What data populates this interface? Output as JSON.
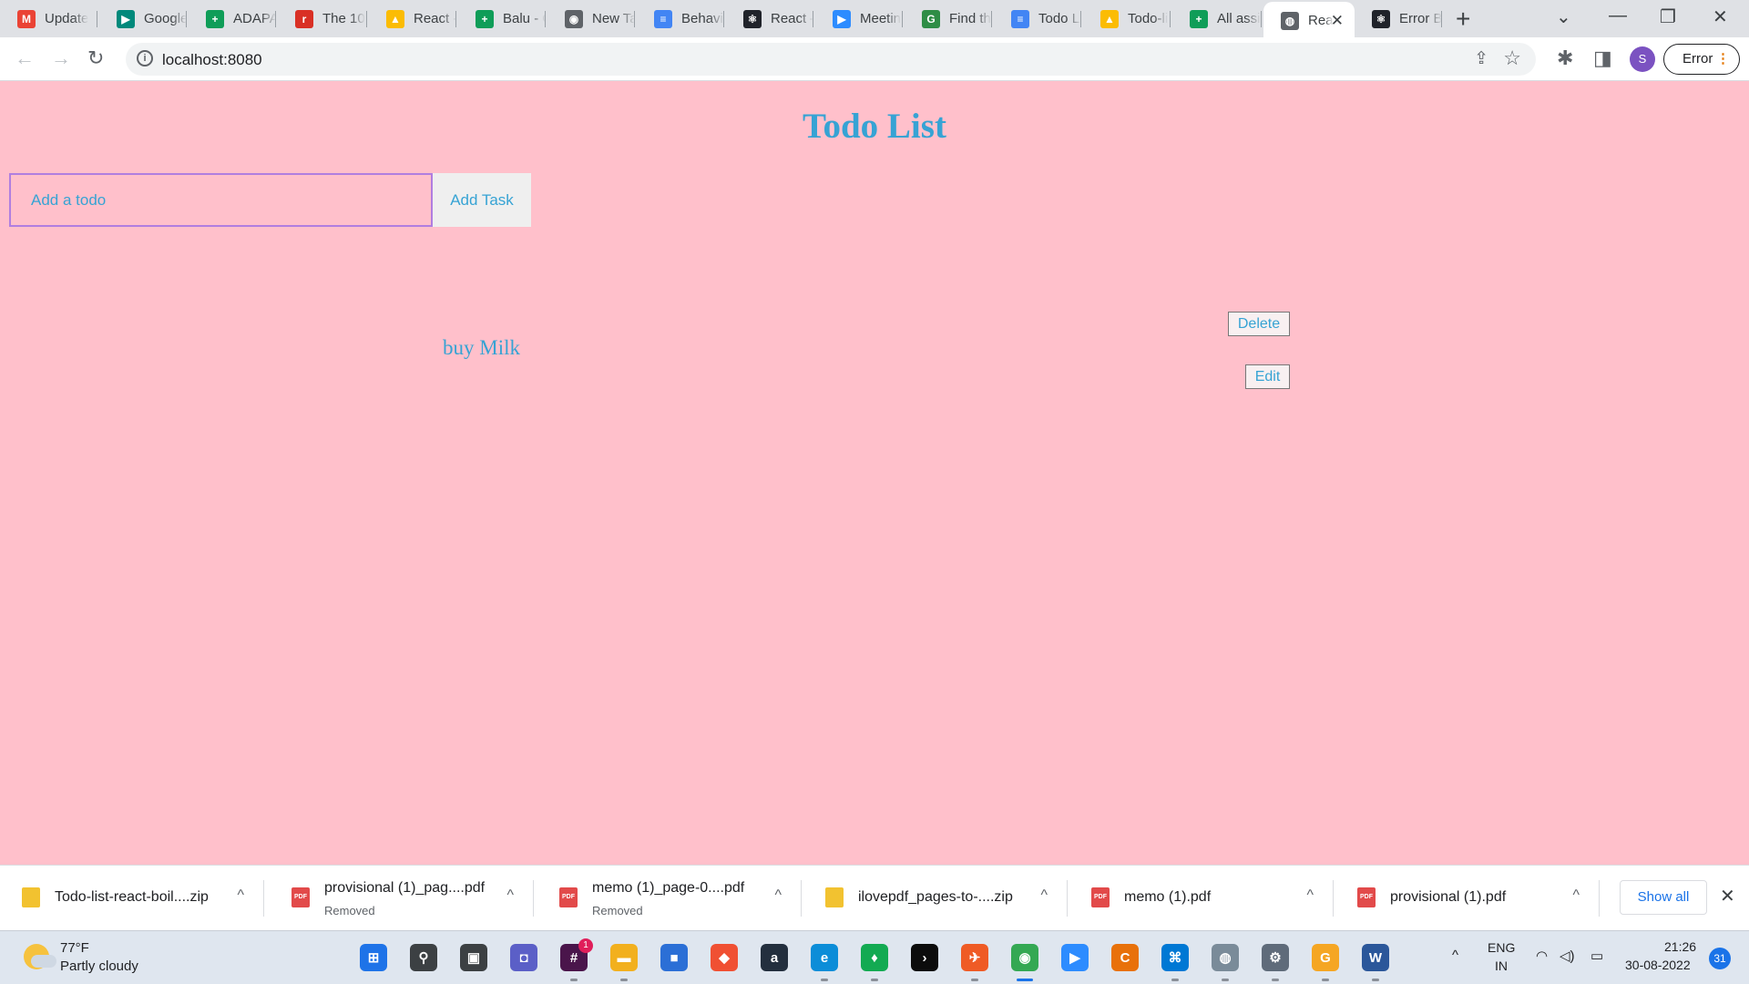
{
  "browser": {
    "tabs": [
      {
        "label": "Update",
        "icon": "gmail-icon",
        "color": "#ea4335",
        "glyph": "M"
      },
      {
        "label": "Google",
        "icon": "google-meet-icon",
        "color": "#00897b",
        "glyph": "▶"
      },
      {
        "label": "ADAPA",
        "icon": "google-sheets-icon",
        "color": "#0f9d58",
        "glyph": "+"
      },
      {
        "label": "The 10",
        "icon": "reduct-icon",
        "color": "#d93025",
        "glyph": "r"
      },
      {
        "label": "React -",
        "icon": "google-drive-icon",
        "color": "#fbbc04",
        "glyph": "▲"
      },
      {
        "label": "Balu - G",
        "icon": "google-sheets-icon",
        "color": "#0f9d58",
        "glyph": "+"
      },
      {
        "label": "New Ta",
        "icon": "chrome-icon",
        "color": "#5f6368",
        "glyph": "◉"
      },
      {
        "label": "Behavio",
        "icon": "google-docs-icon",
        "color": "#4285f4",
        "glyph": "≡"
      },
      {
        "label": "React –",
        "icon": "react-icon",
        "color": "#20232a",
        "glyph": "⚛"
      },
      {
        "label": "Meetin",
        "icon": "zoom-icon",
        "color": "#2d8cff",
        "glyph": "▶"
      },
      {
        "label": "Find th",
        "icon": "geeksforgeeks-icon",
        "color": "#2f8d46",
        "glyph": "G"
      },
      {
        "label": "Todo Li",
        "icon": "google-docs-icon",
        "color": "#4285f4",
        "glyph": "≡"
      },
      {
        "label": "Todo-li",
        "icon": "google-drive-icon",
        "color": "#fbbc04",
        "glyph": "▲"
      },
      {
        "label": "All assi",
        "icon": "google-sheets-icon",
        "color": "#0f9d58",
        "glyph": "+"
      },
      {
        "label": "Rea",
        "icon": "globe-icon",
        "color": "#5f6368",
        "glyph": "◍",
        "active": true
      },
      {
        "label": "Error B",
        "icon": "react-icon",
        "color": "#20232a",
        "glyph": "⚛"
      }
    ],
    "new_tab_glyph": "+",
    "tab_close_glyph": "✕",
    "window": {
      "tab_search": "⌄",
      "minimize": "—",
      "restore": "❐",
      "close": "✕"
    },
    "nav": {
      "back": "←",
      "forward": "→",
      "reload": "↻"
    },
    "url": "localhost:8080",
    "info_glyph": "i",
    "share_glyph": "⇪",
    "star_glyph": "☆",
    "extensions_glyph": "✱",
    "sidepanel_glyph": "◨",
    "profile_initial": "S",
    "error_label": "Error",
    "menu_glyph": "⋮"
  },
  "app": {
    "title": "Todo List",
    "input_placeholder": "Add a todo",
    "input_value": "",
    "add_button": "Add Task",
    "todos": [
      {
        "text": "buy Milk",
        "delete_label": "Delete",
        "edit_label": "Edit"
      }
    ],
    "colors": {
      "background": "#ffc0cb",
      "accent": "#36a3d4",
      "input_border": "#b07ee0"
    }
  },
  "downloads": {
    "items": [
      {
        "name": "Todo-list-react-boil....zip",
        "type": "zip",
        "status": ""
      },
      {
        "name": "provisional (1)_pag....pdf",
        "type": "pdf",
        "status": "Removed"
      },
      {
        "name": "memo (1)_page-0....pdf",
        "type": "pdf",
        "status": "Removed"
      },
      {
        "name": "ilovepdf_pages-to-....zip",
        "type": "zip",
        "status": ""
      },
      {
        "name": "memo (1).pdf",
        "type": "pdf",
        "status": ""
      },
      {
        "name": "provisional (1).pdf",
        "type": "pdf",
        "status": ""
      }
    ],
    "pdf_tag": "PDF",
    "chevron_glyph": "^",
    "show_all": "Show all",
    "close_glyph": "✕"
  },
  "taskbar": {
    "weather": {
      "temp": "77°F",
      "condition": "Partly cloudy"
    },
    "apps": [
      {
        "name": "windows-start-icon",
        "color": "#1e73e8",
        "glyph": "⊞",
        "dot": false
      },
      {
        "name": "search-icon",
        "color": "#3c4043",
        "glyph": "⚲",
        "dot": false
      },
      {
        "name": "task-view-icon",
        "color": "#3c4043",
        "glyph": "▣",
        "dot": false
      },
      {
        "name": "teams-chat-icon",
        "color": "#5b5fc7",
        "glyph": "◘",
        "dot": false
      },
      {
        "name": "slack-icon",
        "color": "#4a154b",
        "glyph": "#",
        "dot": true,
        "badge": "1"
      },
      {
        "name": "file-explorer-icon",
        "color": "#f2b01e",
        "glyph": "▬",
        "dot": true
      },
      {
        "name": "microsoft-store-icon",
        "color": "#2b6fd6",
        "glyph": "■",
        "dot": false
      },
      {
        "name": "git-icon",
        "color": "#f05033",
        "glyph": "◆",
        "dot": false
      },
      {
        "name": "amazon-icon",
        "color": "#232f3e",
        "glyph": "a",
        "dot": false
      },
      {
        "name": "edge-icon",
        "color": "#0c8dd8",
        "glyph": "e",
        "dot": true
      },
      {
        "name": "mongodb-icon",
        "color": "#13aa52",
        "glyph": "♦",
        "dot": true
      },
      {
        "name": "terminal-icon",
        "color": "#0c0c0c",
        "glyph": "›",
        "dot": false
      },
      {
        "name": "postman-icon",
        "color": "#ef5b25",
        "glyph": "✈",
        "dot": true
      },
      {
        "name": "chrome-icon",
        "color": "#34a853",
        "glyph": "◉",
        "dot": true,
        "active": true
      },
      {
        "name": "zoom-icon",
        "color": "#2d8cff",
        "glyph": "▶",
        "dot": false
      },
      {
        "name": "copilot-icon",
        "color": "#e8710a",
        "glyph": "C",
        "dot": false
      },
      {
        "name": "vscode-icon",
        "color": "#0078d4",
        "glyph": "⌘",
        "dot": true
      },
      {
        "name": "network-globe-icon",
        "color": "#7a8b99",
        "glyph": "◍",
        "dot": true
      },
      {
        "name": "settings-icon",
        "color": "#5f6b7a",
        "glyph": "⚙",
        "dot": true
      },
      {
        "name": "grammarly-icon",
        "color": "#f5a623",
        "glyph": "G",
        "dot": true
      },
      {
        "name": "word-icon",
        "color": "#2b579a",
        "glyph": "W",
        "dot": true
      }
    ],
    "tray": {
      "chevron": "^",
      "lang1": "ENG",
      "lang2": "IN",
      "wifi_glyph": "◠",
      "volume_glyph": "◁)",
      "battery_glyph": "▭",
      "time": "21:26",
      "date": "30-08-2022",
      "notification_count": "31"
    }
  }
}
